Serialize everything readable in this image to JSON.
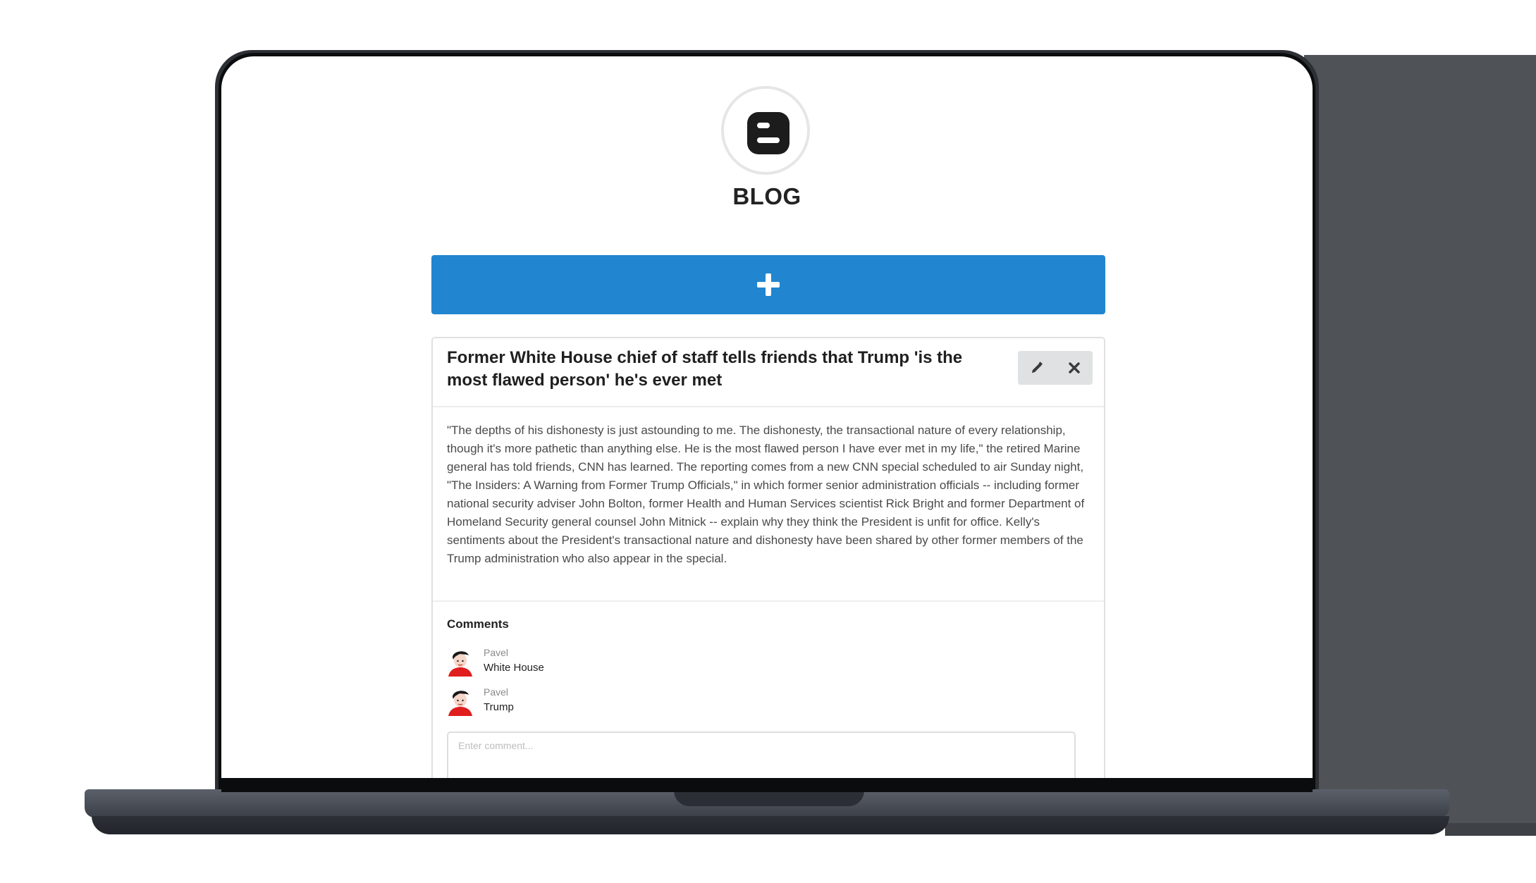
{
  "app": {
    "title": "BLOG",
    "logo_icon": "blogger-logo-icon",
    "add_button_icon": "plus-icon",
    "accent_color": "#2185d0"
  },
  "post": {
    "title": "Former White House chief of staff tells friends that Trump 'is the most flawed person' he's ever met",
    "body": "\"The depths of his dishonesty is just astounding to me. The dishonesty, the transactional nature of every relationship, though it's more pathetic than anything else. He is the most flawed person I have ever met in my life,\" the retired Marine general has told friends, CNN has learned. The reporting comes from a new CNN special scheduled to air Sunday night, \"The Insiders: A Warning from Former Trump Officials,\" in which former senior administration officials -- including former national security adviser John Bolton, former Health and Human Services scientist Rick Bright and former Department of Homeland Security general counsel John Mitnick -- explain why they think the President is unfit for office. Kelly's sentiments about the President's transactional nature and dishonesty have been shared by other former members of the Trump administration who also appear in the special.",
    "actions": [
      {
        "icon": "pencil-icon"
      },
      {
        "icon": "close-icon"
      }
    ]
  },
  "comments": {
    "heading": "Comments",
    "items": [
      {
        "author": "Pavel",
        "text": "White House"
      },
      {
        "author": "Pavel",
        "text": "Trump"
      }
    ],
    "input": {
      "placeholder": "Enter comment...",
      "value": ""
    }
  }
}
